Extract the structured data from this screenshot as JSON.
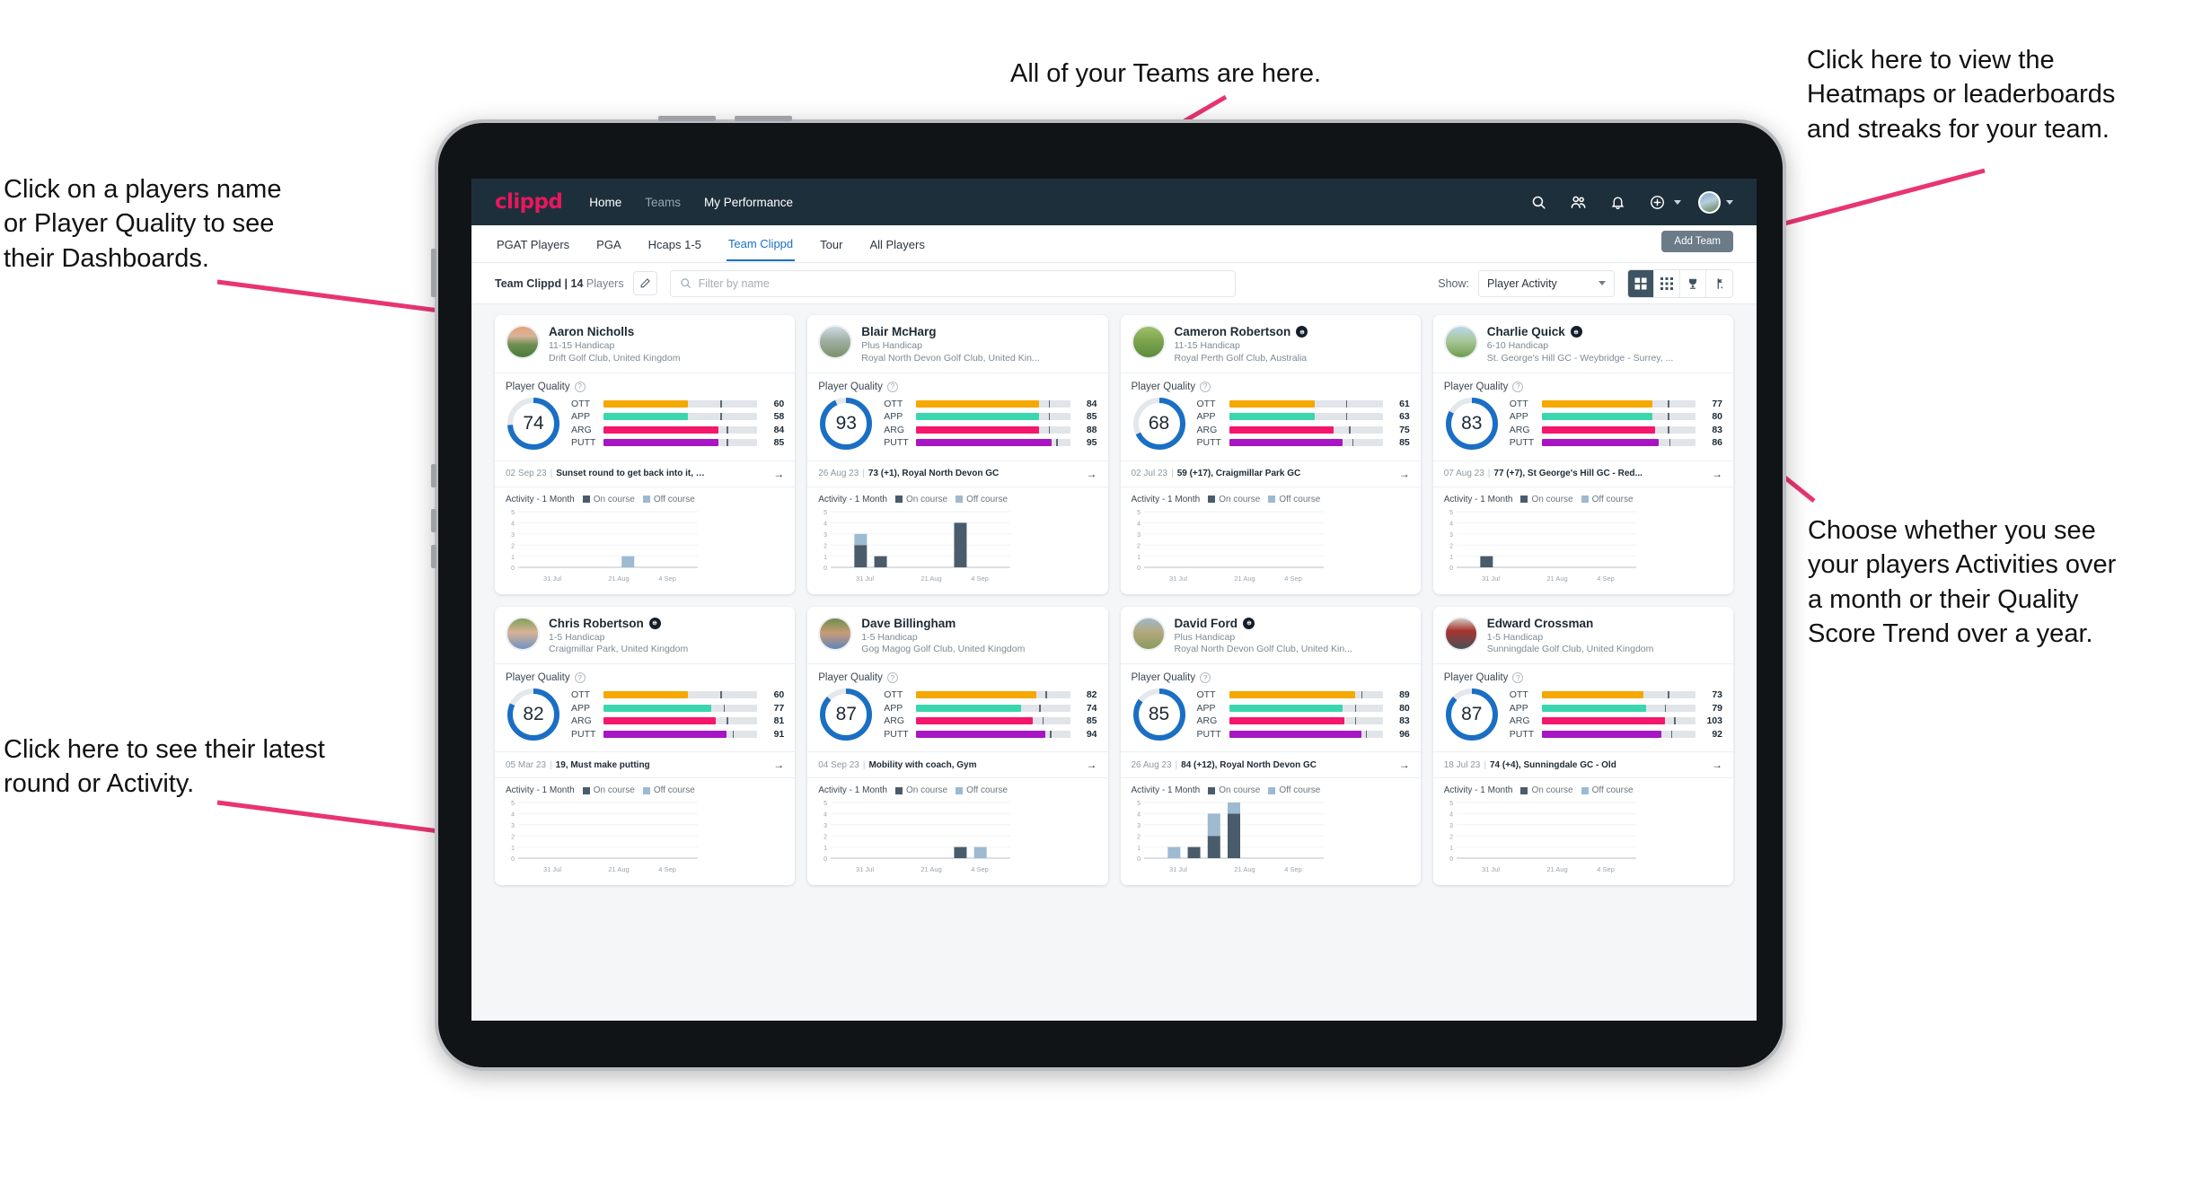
{
  "annotations": [
    {
      "id": "teams",
      "text": "All of your Teams are here."
    },
    {
      "id": "heatmaps",
      "text": "Click here to view the\nHeatmaps or leaderboards\nand streaks for your team."
    },
    {
      "id": "dashboards",
      "text": "Click on a players name\nor Player Quality to see\ntheir Dashboards."
    },
    {
      "id": "activity",
      "text": "Choose whether you see\nyour players Activities over\na month or their Quality\nScore Trend over a year."
    },
    {
      "id": "latest",
      "text": "Click here to see their latest\nround or Activity."
    }
  ],
  "app": {
    "brand": "clippd",
    "nav_links": [
      {
        "label": "Home",
        "active": true
      },
      {
        "label": "Teams",
        "active": false
      },
      {
        "label": "My Performance",
        "active": true
      }
    ],
    "nav_icons": [
      "search-icon",
      "people-icon",
      "bell-icon",
      "plus-circle-icon",
      "avatar-icon"
    ],
    "subtabs": [
      {
        "label": "PGAT Players",
        "state": "normal"
      },
      {
        "label": "PGA",
        "state": "normal"
      },
      {
        "label": "Hcaps 1-5",
        "state": "normal"
      },
      {
        "label": "Team Clippd",
        "state": "active"
      },
      {
        "label": "Tour",
        "state": "normal"
      },
      {
        "label": "All Players",
        "state": "normal"
      }
    ],
    "add_team_label": "Add Team",
    "team_label_bold": "Team Clippd | 14",
    "team_label_light": " Players",
    "edit_icon": "pencil-icon",
    "search": {
      "placeholder": "Filter by name",
      "value": ""
    },
    "show_label": "Show:",
    "show_value": "Player Activity",
    "view_buttons": [
      "grid-large-icon",
      "grid-small-icon",
      "trophy-icon",
      "flag-icon"
    ],
    "active_view": 0
  },
  "colors": {
    "brand": "#e8175d",
    "nav_bg": "#1e2f3c",
    "accent_blue": "#1a6fc4",
    "ott": "#f5a800",
    "app": "#3ad6ad",
    "arg": "#f4176b",
    "putt": "#a715c4",
    "on_course": "#4a5c6b",
    "off_course": "#9dbad1"
  },
  "chart_data": {
    "type": "bar",
    "stacked": true,
    "title": "Activity - 1 Month",
    "legend": [
      "On course",
      "Off course"
    ],
    "xlabel": "",
    "ylabel": "",
    "ylim": [
      0,
      5
    ],
    "yticks": [
      0,
      1,
      2,
      3,
      4,
      5
    ],
    "xticks": [
      "31 Jul",
      "21 Aug",
      "4 Sep"
    ],
    "bins": 9
  },
  "players": [
    {
      "name": "Aaron Nicholls",
      "verified": false,
      "handicap": "11-15 Handicap",
      "club": "Drift Golf Club, United Kingdom",
      "avatar": "sunset-course-photo",
      "quality_label": "Player Quality",
      "quality": 74,
      "metrics": [
        {
          "label": "OTT",
          "value": 60,
          "color": "#f5a800",
          "bar": 55,
          "tick": 76
        },
        {
          "label": "APP",
          "value": 58,
          "color": "#3ad6ad",
          "bar": 55,
          "tick": 76
        },
        {
          "label": "ARG",
          "value": 84,
          "color": "#f4176b",
          "bar": 75,
          "tick": 80
        },
        {
          "label": "PUTT",
          "value": 85,
          "color": "#a715c4",
          "bar": 75,
          "tick": 80
        }
      ],
      "round": {
        "date": "02 Sep 23",
        "title": "Sunset round to get back into it, F..."
      },
      "activity_label": "Activity - 1 Month",
      "activity": {
        "on": [
          0,
          0,
          0,
          0,
          0,
          0,
          0,
          0,
          0
        ],
        "off": [
          0,
          0,
          0,
          0,
          0,
          1,
          0,
          0,
          0
        ]
      }
    },
    {
      "name": "Blair McHarg",
      "verified": false,
      "handicap": "Plus Handicap",
      "club": "Royal North Devon Golf Club, United Kin...",
      "avatar": "links-course-photo",
      "quality_label": "Player Quality",
      "quality": 93,
      "metrics": [
        {
          "label": "OTT",
          "value": 84,
          "color": "#f5a800",
          "bar": 80,
          "tick": 86
        },
        {
          "label": "APP",
          "value": 85,
          "color": "#3ad6ad",
          "bar": 80,
          "tick": 86
        },
        {
          "label": "ARG",
          "value": 88,
          "color": "#f4176b",
          "bar": 80,
          "tick": 86
        },
        {
          "label": "PUTT",
          "value": 95,
          "color": "#a715c4",
          "bar": 88,
          "tick": 91
        }
      ],
      "round": {
        "date": "26 Aug 23",
        "title": "73 (+1), Royal North Devon GC"
      },
      "activity_label": "Activity - 1 Month",
      "activity": {
        "on": [
          0,
          2,
          1,
          0,
          0,
          0,
          4,
          0,
          0
        ],
        "off": [
          0,
          1,
          0,
          0,
          0,
          0,
          0,
          0,
          0
        ]
      }
    },
    {
      "name": "Cameron Robertson",
      "verified": true,
      "handicap": "11-15 Handicap",
      "club": "Royal Perth Golf Club, Australia",
      "avatar": "fairway-photo",
      "quality_label": "Player Quality",
      "quality": 68,
      "metrics": [
        {
          "label": "OTT",
          "value": 61,
          "color": "#f5a800",
          "bar": 56,
          "tick": 76
        },
        {
          "label": "APP",
          "value": 63,
          "color": "#3ad6ad",
          "bar": 56,
          "tick": 76
        },
        {
          "label": "ARG",
          "value": 75,
          "color": "#f4176b",
          "bar": 68,
          "tick": 78
        },
        {
          "label": "PUTT",
          "value": 85,
          "color": "#a715c4",
          "bar": 74,
          "tick": 80
        }
      ],
      "round": {
        "date": "02 Jul 23",
        "title": "59 (+17), Craigmillar Park GC"
      },
      "activity_label": "Activity - 1 Month",
      "activity": {
        "on": [
          0,
          0,
          0,
          0,
          0,
          0,
          0,
          0,
          0
        ],
        "off": [
          0,
          0,
          0,
          0,
          0,
          0,
          0,
          0,
          0
        ]
      }
    },
    {
      "name": "Charlie Quick",
      "verified": true,
      "handicap": "6-10 Handicap",
      "club": "St. George's Hill GC - Weybridge - Surrey, ...",
      "avatar": "green-photo",
      "quality_label": "Player Quality",
      "quality": 83,
      "metrics": [
        {
          "label": "OTT",
          "value": 77,
          "color": "#f5a800",
          "bar": 72,
          "tick": 82
        },
        {
          "label": "APP",
          "value": 80,
          "color": "#3ad6ad",
          "bar": 72,
          "tick": 82
        },
        {
          "label": "ARG",
          "value": 83,
          "color": "#f4176b",
          "bar": 74,
          "tick": 82
        },
        {
          "label": "PUTT",
          "value": 86,
          "color": "#a715c4",
          "bar": 76,
          "tick": 83
        }
      ],
      "round": {
        "date": "07 Aug 23",
        "title": "77 (+7), St George's Hill GC - Red..."
      },
      "activity_label": "Activity - 1 Month",
      "activity": {
        "on": [
          0,
          1,
          0,
          0,
          0,
          0,
          0,
          0,
          0
        ],
        "off": [
          0,
          0,
          0,
          0,
          0,
          0,
          0,
          0,
          0
        ]
      }
    },
    {
      "name": "Chris Robertson",
      "verified": true,
      "handicap": "1-5 Handicap",
      "club": "Craigmillar Park, United Kingdom",
      "avatar": "man-glasses-photo",
      "quality_label": "Player Quality",
      "quality": 82,
      "metrics": [
        {
          "label": "OTT",
          "value": 60,
          "color": "#f5a800",
          "bar": 55,
          "tick": 76
        },
        {
          "label": "APP",
          "value": 77,
          "color": "#3ad6ad",
          "bar": 70,
          "tick": 78
        },
        {
          "label": "ARG",
          "value": 81,
          "color": "#f4176b",
          "bar": 73,
          "tick": 80
        },
        {
          "label": "PUTT",
          "value": 91,
          "color": "#a715c4",
          "bar": 80,
          "tick": 84
        }
      ],
      "round": {
        "date": "05 Mar 23",
        "title": "19, Must make putting"
      },
      "activity_label": "Activity - 1 Month",
      "activity": {
        "on": [
          0,
          0,
          0,
          0,
          0,
          0,
          0,
          0,
          0
        ],
        "off": [
          0,
          0,
          0,
          0,
          0,
          0,
          0,
          0,
          0
        ]
      }
    },
    {
      "name": "Dave Billingham",
      "verified": false,
      "handicap": "1-5 Handicap",
      "club": "Gog Magog Golf Club, United Kingdom",
      "avatar": "man-beard-photo",
      "quality_label": "Player Quality",
      "quality": 87,
      "metrics": [
        {
          "label": "OTT",
          "value": 82,
          "color": "#f5a800",
          "bar": 78,
          "tick": 84
        },
        {
          "label": "APP",
          "value": 74,
          "color": "#3ad6ad",
          "bar": 68,
          "tick": 80
        },
        {
          "label": "ARG",
          "value": 85,
          "color": "#f4176b",
          "bar": 76,
          "tick": 82
        },
        {
          "label": "PUTT",
          "value": 94,
          "color": "#a715c4",
          "bar": 84,
          "tick": 87
        }
      ],
      "round": {
        "date": "04 Sep 23",
        "title": "Mobility with coach, Gym"
      },
      "activity_label": "Activity - 1 Month",
      "activity": {
        "on": [
          0,
          0,
          0,
          0,
          0,
          0,
          1,
          0,
          0
        ],
        "off": [
          0,
          0,
          0,
          0,
          0,
          0,
          0,
          1,
          0
        ]
      }
    },
    {
      "name": "David Ford",
      "verified": true,
      "handicap": "Plus Handicap",
      "club": "Royal North Devon Golf Club, United Kin...",
      "avatar": "coastal-photo",
      "quality_label": "Player Quality",
      "quality": 85,
      "metrics": [
        {
          "label": "OTT",
          "value": 89,
          "color": "#f5a800",
          "bar": 82,
          "tick": 86
        },
        {
          "label": "APP",
          "value": 80,
          "color": "#3ad6ad",
          "bar": 74,
          "tick": 82
        },
        {
          "label": "ARG",
          "value": 83,
          "color": "#f4176b",
          "bar": 75,
          "tick": 82
        },
        {
          "label": "PUTT",
          "value": 96,
          "color": "#a715c4",
          "bar": 86,
          "tick": 89
        }
      ],
      "round": {
        "date": "26 Aug 23",
        "title": "84 (+12), Royal North Devon GC"
      },
      "activity_label": "Activity - 1 Month",
      "activity": {
        "on": [
          0,
          0,
          1,
          2,
          4,
          0,
          0,
          0,
          0
        ],
        "off": [
          0,
          1,
          0,
          2,
          1,
          0,
          0,
          0,
          0
        ]
      }
    },
    {
      "name": "Edward Crossman",
      "verified": false,
      "handicap": "1-5 Handicap",
      "club": "Sunningdale Golf Club, United Kingdom",
      "avatar": "indoor-photo",
      "quality_label": "Player Quality",
      "quality": 87,
      "metrics": [
        {
          "label": "OTT",
          "value": 73,
          "color": "#f5a800",
          "bar": 66,
          "tick": 82
        },
        {
          "label": "APP",
          "value": 79,
          "color": "#3ad6ad",
          "bar": 68,
          "tick": 80
        },
        {
          "label": "ARG",
          "value": 103,
          "color": "#f4176b",
          "bar": 80,
          "tick": 86
        },
        {
          "label": "PUTT",
          "value": 92,
          "color": "#a715c4",
          "bar": 78,
          "tick": 84
        }
      ],
      "round": {
        "date": "18 Jul 23",
        "title": "74 (+4), Sunningdale GC - Old"
      },
      "activity_label": "Activity - 1 Month",
      "activity": {
        "on": [
          0,
          0,
          0,
          0,
          0,
          0,
          0,
          0,
          0
        ],
        "off": [
          0,
          0,
          0,
          0,
          0,
          0,
          0,
          0,
          0
        ]
      }
    }
  ]
}
